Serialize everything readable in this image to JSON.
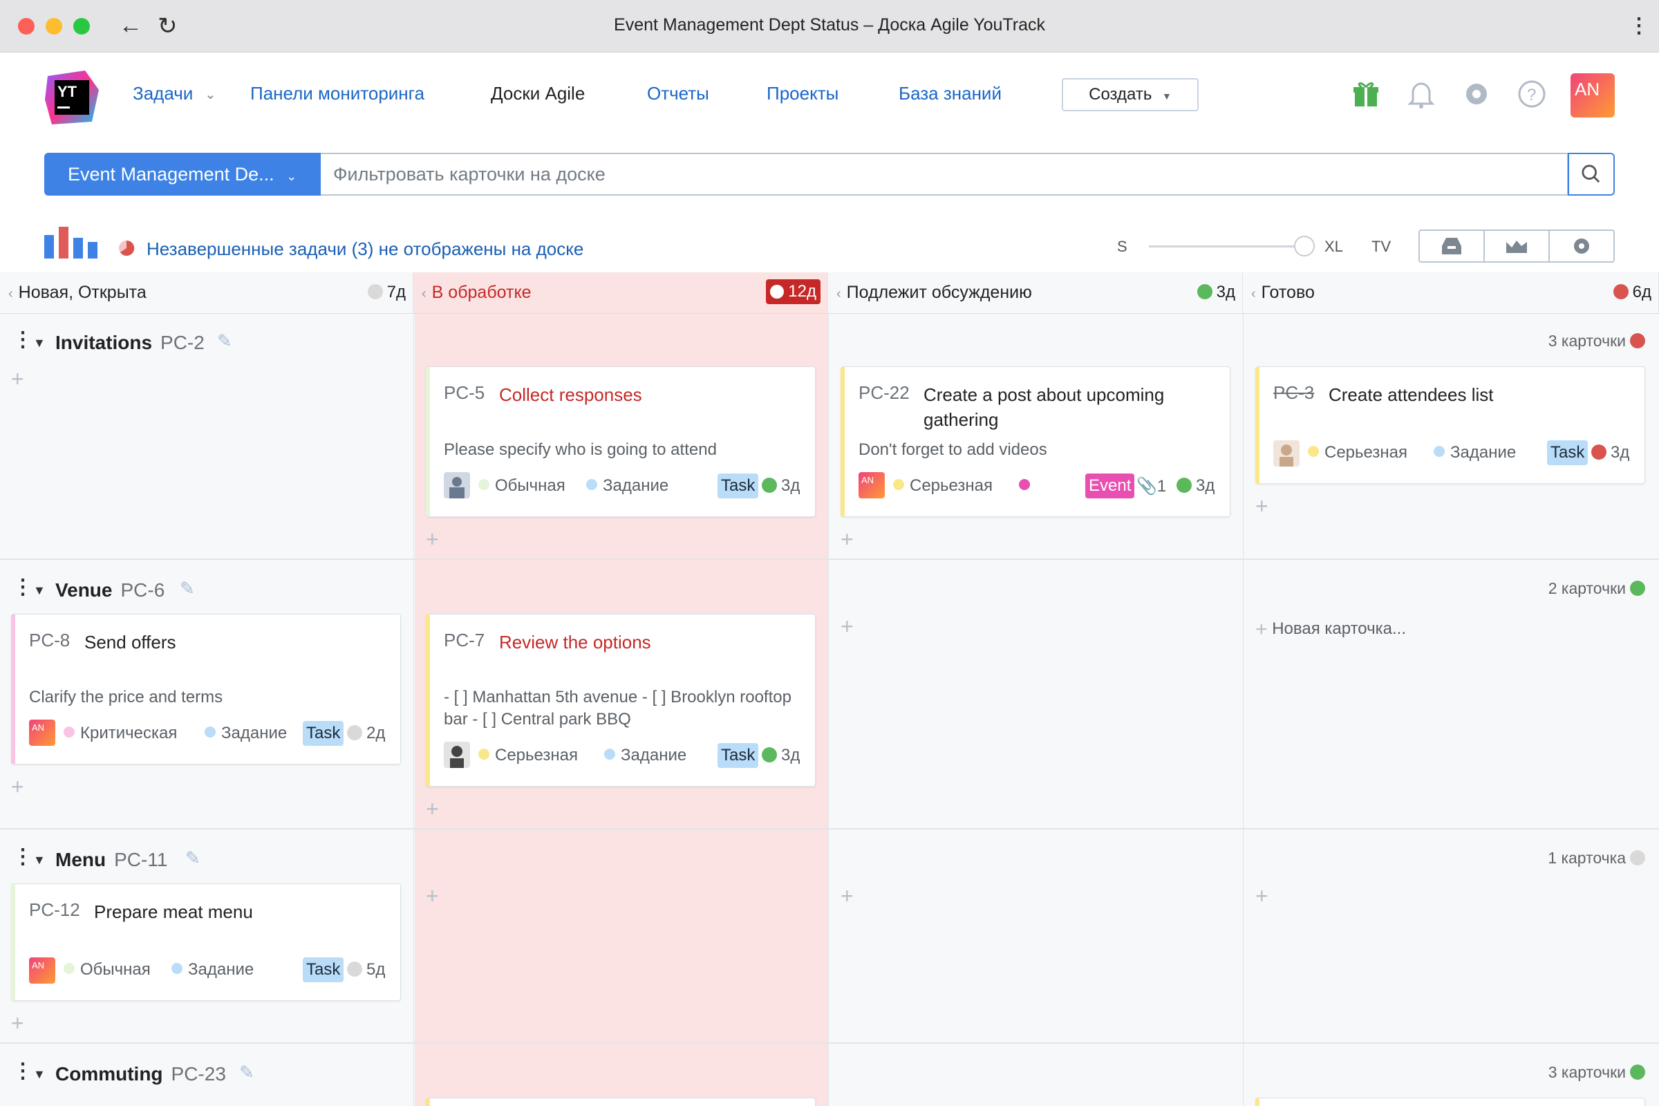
{
  "window": {
    "title": "Event Management Dept Status – Доска Agile YouTrack"
  },
  "nav": {
    "issues": "Задачи",
    "dashboards": "Панели мониторинга",
    "agile": "Доски Agile",
    "reports": "Отчеты",
    "projects": "Проекты",
    "kb": "База знаний",
    "create": "Создать",
    "avatar": "AN"
  },
  "toolbar": {
    "board_name": "Event Management De...",
    "filter_placeholder": "Фильтровать карточки на доске",
    "unfinished": "Незавершенные задачи (3) не отображены на доске",
    "size_s": "S",
    "size_xl": "XL",
    "size_tv": "TV"
  },
  "columns": [
    {
      "name": "Новая, Открыта",
      "time": "7д",
      "color": "#d9d9d9"
    },
    {
      "name": "В обработке",
      "time": "12д",
      "color": "#c62828"
    },
    {
      "name": "Подлежит обсуждению",
      "time": "3д",
      "color": "#5cb85c"
    },
    {
      "name": "Готово",
      "time": "6д",
      "color": "#d9534f"
    }
  ],
  "swimlanes": [
    {
      "title": "Invitations",
      "id": "PC-2",
      "count": "3 карточки",
      "count_color": "#d9534f"
    },
    {
      "title": "Venue",
      "id": "PC-6",
      "count": "2 карточки",
      "count_color": "#5cb85c"
    },
    {
      "title": "Menu",
      "id": "PC-11",
      "count": "1 карточка",
      "count_color": "#d9d9d9"
    },
    {
      "title": "Commuting",
      "id": "PC-23",
      "count": "3 карточки",
      "count_color": "#5cb85c"
    }
  ],
  "cards": {
    "pc5": {
      "id": "PC-5",
      "title": "Collect responses",
      "desc": "Please specify who is going to attend",
      "priority": "Обычная",
      "type": "Задание",
      "tag": "Task",
      "est": "3д"
    },
    "pc22": {
      "id": "PC-22",
      "title": "Create a post about upcoming gathering",
      "desc": "Don't forget to add videos",
      "priority": "Серьезная",
      "tag": "Event",
      "attach": "1",
      "est": "3д",
      "avatar": "AN"
    },
    "pc3": {
      "id": "PC-3",
      "title": "Create attendees list",
      "priority": "Серьезная",
      "type": "Задание",
      "tag": "Task",
      "est": "3д"
    },
    "pc8": {
      "id": "PC-8",
      "title": "Send offers",
      "desc": "Clarify the price and terms",
      "priority": "Критическая",
      "type": "Задание",
      "tag": "Task",
      "est": "2д",
      "avatar": "AN"
    },
    "pc7": {
      "id": "PC-7",
      "title": "Review the options",
      "desc": "- [ ] Manhattan 5th avenue - [ ] Brooklyn rooftop bar - [ ] Central park BBQ",
      "priority": "Серьезная",
      "type": "Задание",
      "tag": "Task",
      "est": "3д"
    },
    "pc12": {
      "id": "PC-12",
      "title": "Prepare meat menu",
      "priority": "Обычная",
      "type": "Задание",
      "tag": "Task",
      "est": "5д",
      "avatar": "AN"
    }
  },
  "new_card": "Новая карточка...",
  "colors": {
    "accent": "#3d82e4",
    "in_progress_bg": "#fbe3e3",
    "task_tag": "#b9dcf8",
    "event_tag": "#e84fb0"
  }
}
